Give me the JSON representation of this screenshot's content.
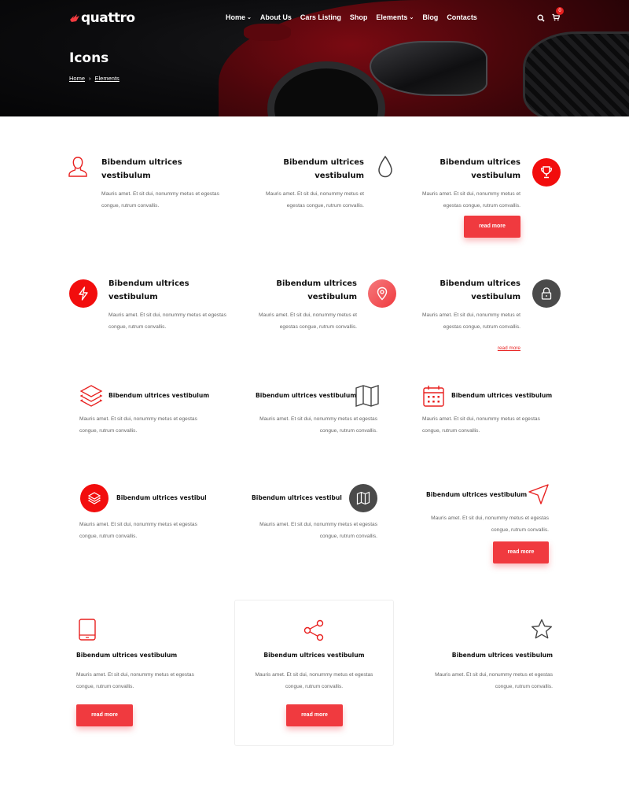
{
  "header": {
    "logo_text": "quattro",
    "nav": [
      {
        "label": "Home",
        "dropdown": true
      },
      {
        "label": "About Us",
        "dropdown": false
      },
      {
        "label": "Cars Listing",
        "dropdown": false
      },
      {
        "label": "Shop",
        "dropdown": false
      },
      {
        "label": "Elements",
        "dropdown": true
      },
      {
        "label": "Blog",
        "dropdown": false
      },
      {
        "label": "Contacts",
        "dropdown": false
      }
    ],
    "cart_count": "0"
  },
  "hero": {
    "title": "Icons",
    "breadcrumb": [
      "Home",
      "Elements"
    ]
  },
  "colors": {
    "accent": "#f03a3f",
    "accent_dark": "#e8201f",
    "dark_icon": "#4a4a4a",
    "hero_bg": "#0c0c0e"
  },
  "boxes": [
    {
      "icon": "user-icon",
      "title": "Bibendum ultrices vestibulum",
      "desc": "Mauris amet. Et sit dui, nonummy metus et egestas congue, rutrum convallis."
    },
    {
      "icon": "drop-icon",
      "title": "Bibendum ultrices vestibulum",
      "desc": "Mauris amet. Et sit dui, nonummy metus et egestas congue, rutrum convallis."
    },
    {
      "icon": "trophy-icon",
      "title": "Bibendum ultrices vestibulum",
      "desc": "Mauris amet. Et sit dui, nonummy metus et egestas congue, rutrum convallis.",
      "button": "read more"
    },
    {
      "icon": "lightning-icon",
      "title": "Bibendum ultrices vestibulum",
      "desc": "Mauris amet. Et sit dui, nonummy metus et egestas congue, rutrum convallis."
    },
    {
      "icon": "location-pin-icon",
      "title": "Bibendum ultrices vestibulum",
      "desc": "Mauris amet. Et sit dui, nonummy metus et egestas congue, rutrum convallis."
    },
    {
      "icon": "lock-icon",
      "title": "Bibendum ultrices vestibulum",
      "desc": "Mauris amet. Et sit dui, nonummy metus et egestas congue, rutrum convallis.",
      "link": "read more"
    },
    {
      "icon": "layers-icon",
      "title": "Bibendum ultrices vestibulum",
      "desc": "Mauris amet. Et sit dui, nonummy metus et egestas congue, rutrum convallis."
    },
    {
      "icon": "map-icon",
      "title": "Bibendum ultrices vestibulum",
      "desc": "Mauris amet. Et sit dui, nonummy metus et egestas congue, rutrum convallis."
    },
    {
      "icon": "calendar-icon",
      "title": "Bibendum ultrices vestibulum",
      "desc": "Mauris amet. Et sit dui, nonummy metus et egestas congue, rutrum convallis."
    },
    {
      "icon": "layers-icon",
      "title": "Bibendum ultrices vestibulum",
      "desc": "Mauris amet. Et sit dui, nonummy metus et egestas congue, rutrum convallis."
    },
    {
      "icon": "map-icon",
      "title": "Bibendum ultrices vestibulum",
      "desc": "Mauris amet. Et sit dui, nonummy metus et egestas congue, rutrum convallis."
    },
    {
      "icon": "navigation-arrow-icon",
      "title": "Bibendum ultrices vestibulum",
      "desc": "Mauris amet. Et sit dui, nonummy metus et egestas congue, rutrum convallis.",
      "button": "read more"
    },
    {
      "icon": "tablet-icon",
      "title": "Bibendum ultrices vestibulum",
      "desc": "Mauris amet. Et sit dui, nonummy metus et egestas congue, rutrum convallis.",
      "button": "read more"
    },
    {
      "icon": "share-icon",
      "title": "Bibendum ultrices vestibulum",
      "desc": "Mauris amet. Et sit dui, nonummy metus et egestas congue, rutrum convallis.",
      "button": "read more"
    },
    {
      "icon": "star-icon",
      "title": "Bibendum ultrices vestibulum",
      "desc": "Mauris amet. Et sit dui, nonummy metus et egestas congue, rutrum convallis."
    }
  ]
}
